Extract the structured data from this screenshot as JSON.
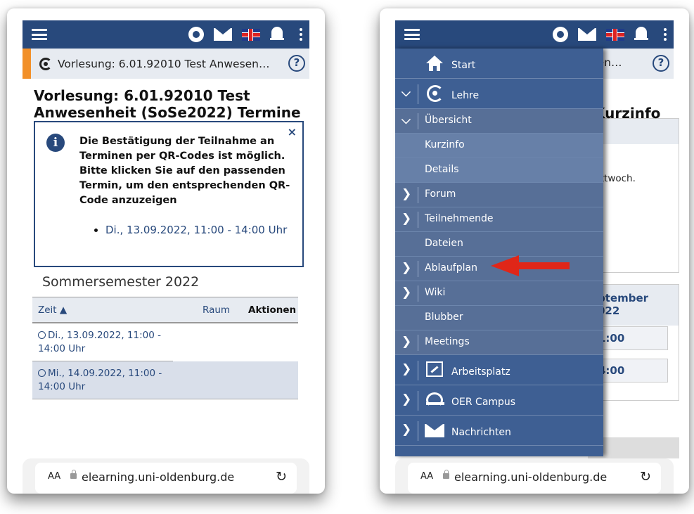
{
  "left": {
    "breadcrumb": "Vorlesung: 6.01.92010 Test Anwesen…",
    "help": "?",
    "title_line1": "Vorlesung: 6.01.92010 Test",
    "title_line2": "Anwesenheit (SoSe2022) Termine",
    "info": {
      "icon": "i",
      "close": "×",
      "text": "Die Bestätigung der Teilnahme an Terminen per QR-Codes ist möglich. Bitte klicken Sie auf den passenden Termin, um den entsprechenden QR-Code anzuzeigen",
      "link": "Di., 13.09.2022, 11:00 - 14:00 Uhr"
    },
    "semester": "Sommersemester 2022",
    "table": {
      "col_zeit": "Zeit ▲",
      "col_raum": "Raum",
      "col_aktionen": "Aktionen",
      "row1": "Di., 13.09.2022, 11:00 - 14:00 Uhr",
      "row2": "Mi., 14.09.2022, 11:00 - 14:00 Uhr"
    }
  },
  "urlbar": {
    "aa": "AA",
    "url": "elearning.uni-oldenburg.de",
    "reload": "↻"
  },
  "right": {
    "bg_crumb": "esen…",
    "bg_title": "Kurzinfo",
    "bg_text": "ittwoch.",
    "bg_head": "ptember\n022",
    "bg_slot1": "1:00",
    "bg_slot2": "4:00",
    "menu": {
      "start": "Start",
      "lehre": "Lehre",
      "uebersicht": "Übersicht",
      "kurzinfo": "Kurzinfo",
      "details": "Details",
      "forum": "Forum",
      "teilnehmende": "Teilnehmende",
      "dateien": "Dateien",
      "ablaufplan": "Ablaufplan",
      "wiki": "Wiki",
      "blubber": "Blubber",
      "meetings": "Meetings",
      "arbeitsplatz": "Arbeitsplatz",
      "oer": "OER Campus",
      "nachrichten": "Nachrichten"
    }
  },
  "colors": {
    "topbar": "#28497c",
    "accent": "#f29029",
    "drawer": "#3e5f93",
    "arrow": "#e02618"
  }
}
